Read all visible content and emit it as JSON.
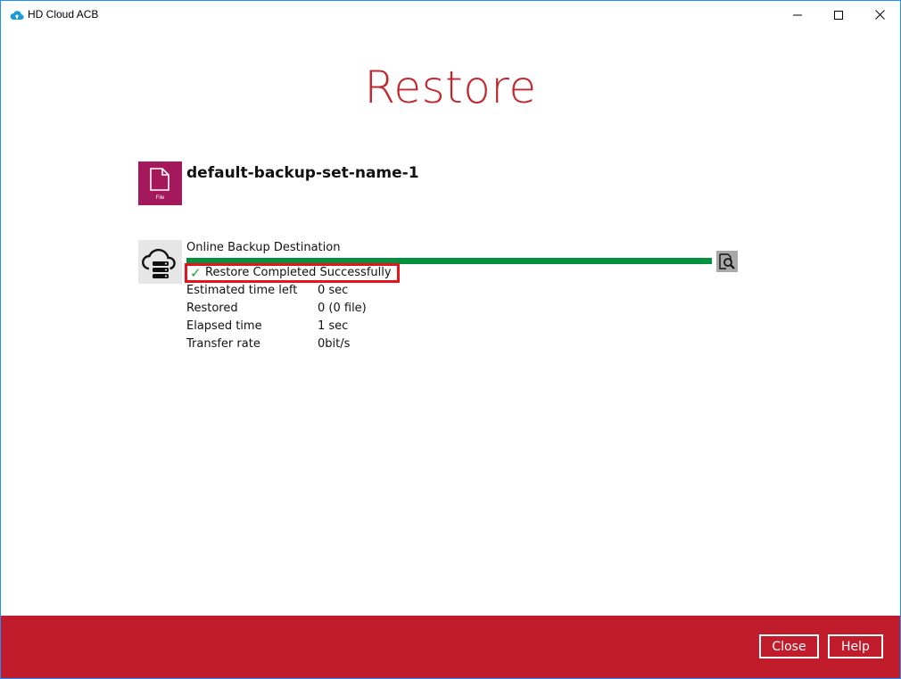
{
  "window": {
    "title": "HD Cloud ACB",
    "controls": {
      "minimize_icon": "minimize-icon",
      "maximize_icon": "maximize-icon",
      "close_icon": "close-icon"
    }
  },
  "page": {
    "heading": "Restore"
  },
  "backup_set": {
    "icon": "file-icon",
    "icon_label": "File",
    "name": "default-backup-set-name-1"
  },
  "destination": {
    "icon": "cloud-server-icon",
    "title": "Online Backup Destination",
    "progress": 1.0,
    "status_icon": "check-icon",
    "status_glyph": "✓",
    "status": "Restore Completed Successfully",
    "details_icon": "magnify-document-icon",
    "stats": [
      {
        "label": "Estimated time left",
        "value": "0 sec"
      },
      {
        "label": "Restored",
        "value": "0 (0 file)"
      },
      {
        "label": "Elapsed time",
        "value": "1 sec"
      },
      {
        "label": "Transfer rate",
        "value": "0bit/s"
      }
    ]
  },
  "footer": {
    "close_label": "Close",
    "help_label": "Help"
  },
  "colors": {
    "accent": "#c01c2c",
    "heading": "#c1272d",
    "file_tile": "#a4195b",
    "progress": "#00913f",
    "highlight_box": "#e8141d",
    "check": "#1b9e3a"
  }
}
